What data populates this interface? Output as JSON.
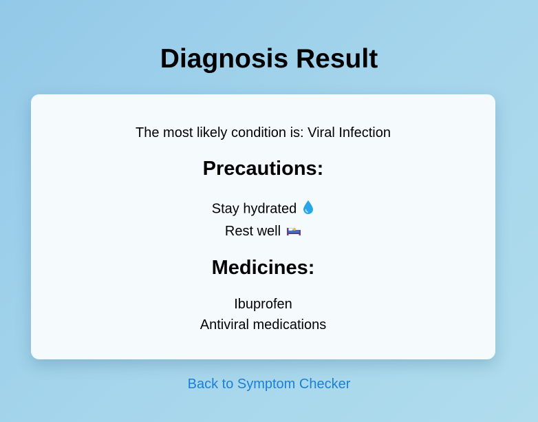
{
  "page": {
    "title": "Diagnosis Result"
  },
  "result": {
    "condition_text": "The most likely condition is: Viral Infection"
  },
  "precautions": {
    "heading": "Precautions:",
    "items": [
      {
        "label": "Stay hydrated",
        "icon": "water-drop-icon"
      },
      {
        "label": "Rest well",
        "icon": "bed-icon"
      }
    ]
  },
  "medicines": {
    "heading": "Medicines:",
    "items": [
      "Ibuprofen",
      "Antiviral medications"
    ]
  },
  "navigation": {
    "back_label": "Back to Symptom Checker"
  },
  "colors": {
    "link": "#1a7fd6",
    "card_background": "#f5fafc",
    "page_gradient_start": "#93c9e8",
    "page_gradient_end": "#b0dced"
  }
}
